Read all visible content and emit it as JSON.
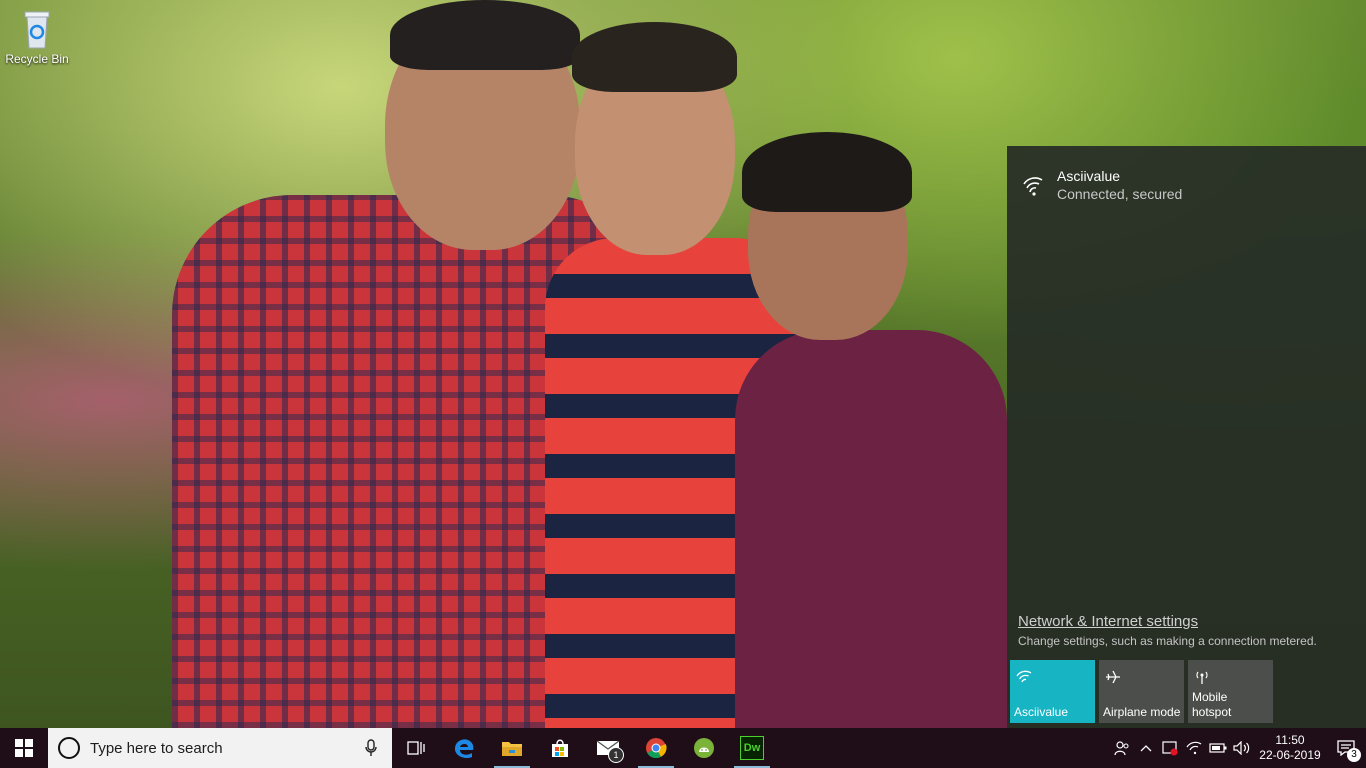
{
  "desktop": {
    "icons": [
      {
        "label": "Recycle Bin",
        "icon": "recycle-bin-icon"
      }
    ]
  },
  "network_flyout": {
    "network": {
      "name": "Asciivalue",
      "status": "Connected, secured",
      "icon": "wifi-icon"
    },
    "settings_link": "Network & Internet settings",
    "settings_description": "Change settings, such as making a connection metered.",
    "quick_actions": [
      {
        "label": "Asciivalue",
        "icon": "wifi-icon",
        "active": true
      },
      {
        "label": "Airplane mode",
        "icon": "airplane-icon",
        "active": false
      },
      {
        "label": "Mobile hotspot",
        "icon": "hotspot-icon",
        "active": false
      }
    ],
    "accent_color": "#17b4c4"
  },
  "taskbar": {
    "search_placeholder": "Type here to search",
    "apps": [
      {
        "name": "Task View",
        "icon": "task-view-icon"
      },
      {
        "name": "Microsoft Edge",
        "icon": "edge-icon"
      },
      {
        "name": "File Explorer",
        "icon": "file-explorer-icon"
      },
      {
        "name": "Microsoft Store",
        "icon": "store-icon"
      },
      {
        "name": "Mail",
        "icon": "mail-icon",
        "badge": "1"
      },
      {
        "name": "Google Chrome",
        "icon": "chrome-icon"
      },
      {
        "name": "Android Studio",
        "icon": "android-studio-icon"
      },
      {
        "name": "Dreamweaver",
        "icon": "dreamweaver-icon",
        "label": "Dw"
      }
    ],
    "tray": {
      "icons": [
        "people-icon",
        "chevron-up-icon",
        "security-alert-icon",
        "wifi-icon",
        "battery-icon",
        "volume-icon"
      ],
      "time": "11:50",
      "date": "22-06-2019",
      "notification_count": "3"
    }
  }
}
